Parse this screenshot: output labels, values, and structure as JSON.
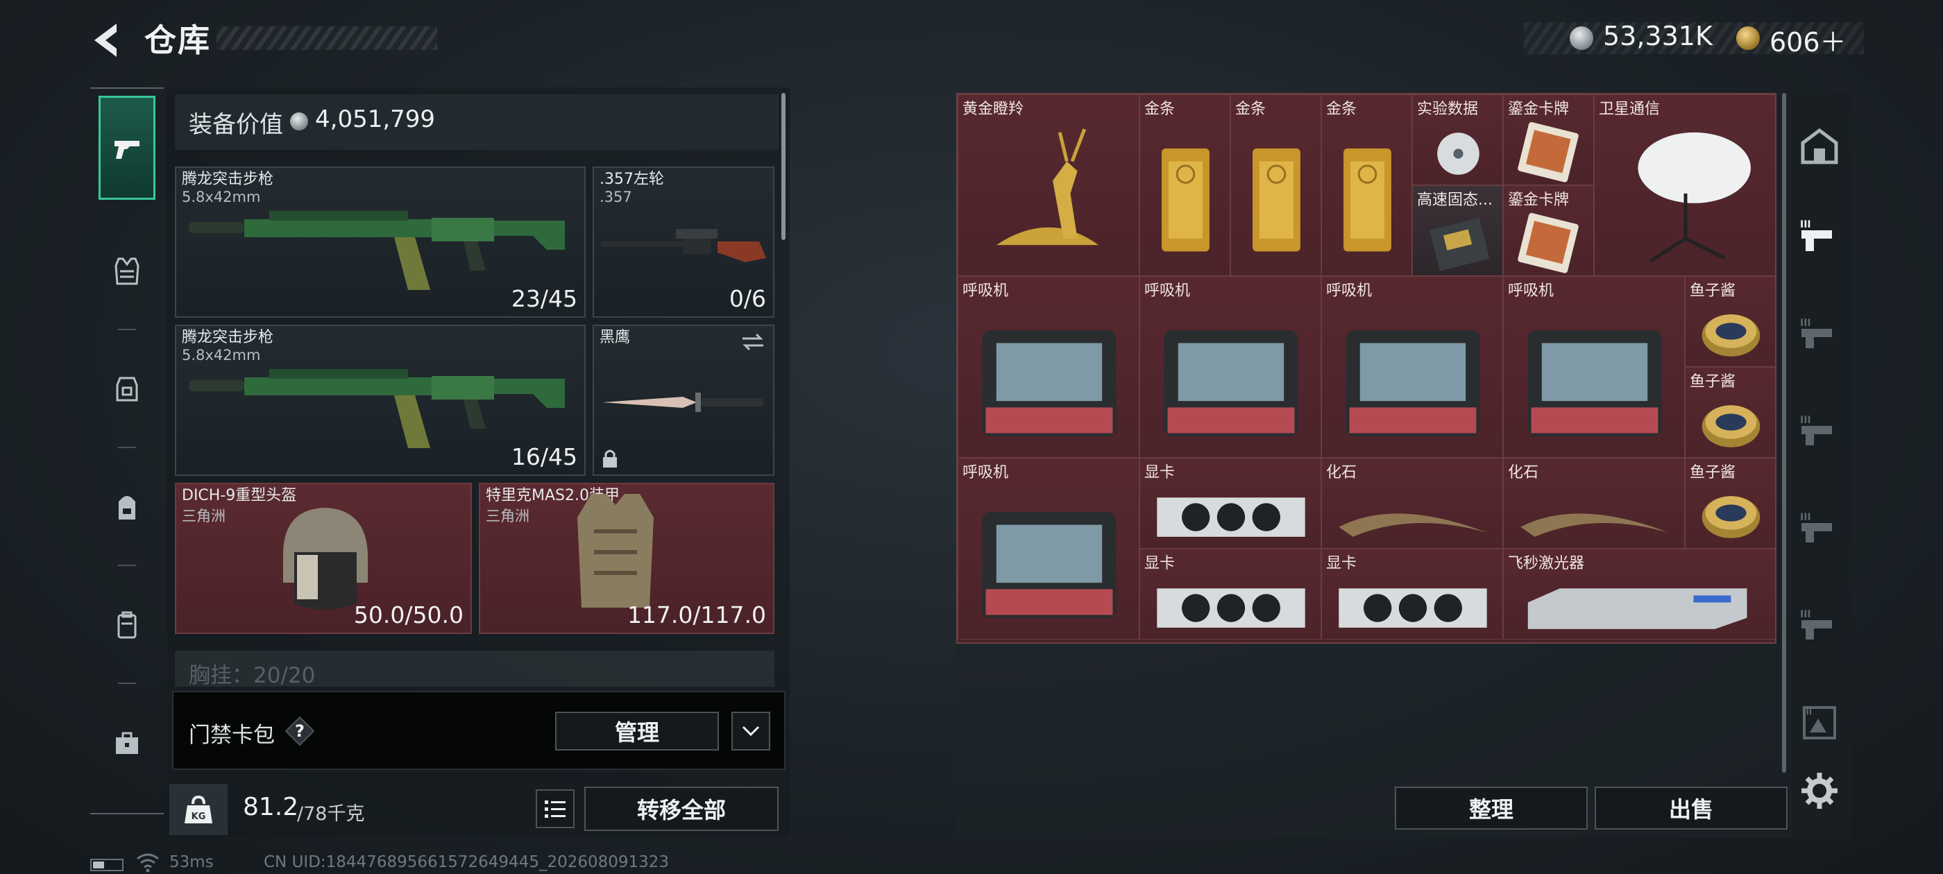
{
  "header": {
    "title": "仓库",
    "money_silver": "53,331K",
    "money_gold": "606＋"
  },
  "equipment": {
    "label": "装备价值",
    "value": "4,051,799",
    "slots": [
      {
        "name": "腾龙突击步枪",
        "sub": "5.8x42mm",
        "value": "23/45"
      },
      {
        "name": ".357左轮",
        "sub": ".357",
        "value": "0/6"
      },
      {
        "name": "腾龙突击步枪",
        "sub": "5.8x42mm",
        "value": "16/45"
      },
      {
        "name": "黑鹰",
        "sub": "",
        "value": ""
      },
      {
        "name": "DICH-9重型头盔",
        "sub": "三角洲",
        "value": "50.0/50.0"
      },
      {
        "name": "特里克MAS2.0装甲",
        "sub": "三角洲",
        "value": "117.0/117.0"
      }
    ],
    "chest_label": "胸挂：20/20"
  },
  "card_pack": {
    "label": "门禁卡包",
    "help": "?",
    "manage": "管理"
  },
  "weight": {
    "current": "81.2",
    "max": "/78千克",
    "icon_text": "KG"
  },
  "buttons": {
    "transfer_all": "转移全部",
    "sort": "整理",
    "sell": "出售"
  },
  "status": {
    "ping": "53ms",
    "uid": "CN UID:1844768956615726494​45_202608091323"
  },
  "storage_items": [
    {
      "label": "黄金瞪羚",
      "icon": "gold-gazelle-icon"
    },
    {
      "label": "金条",
      "icon": "gold-bar-icon"
    },
    {
      "label": "金条",
      "icon": "gold-bar-icon"
    },
    {
      "label": "金条",
      "icon": "gold-bar-icon"
    },
    {
      "label": "实验数据",
      "icon": "data-disc-icon"
    },
    {
      "label": "鎏金卡牌",
      "icon": "gilded-card-icon"
    },
    {
      "label": "卫星通信",
      "icon": "satellite-dish-icon"
    },
    {
      "label": "高速固态...",
      "icon": "ssd-icon"
    },
    {
      "label": "鎏金卡牌",
      "icon": "gilded-card-icon"
    },
    {
      "label": "呼吸机",
      "icon": "ventilator-icon"
    },
    {
      "label": "呼吸机",
      "icon": "ventilator-icon"
    },
    {
      "label": "呼吸机",
      "icon": "ventilator-icon"
    },
    {
      "label": "呼吸机",
      "icon": "ventilator-icon"
    },
    {
      "label": "鱼子酱",
      "icon": "caviar-tin-icon"
    },
    {
      "label": "鱼子酱",
      "icon": "caviar-tin-icon"
    },
    {
      "label": "呼吸机",
      "icon": "ventilator-icon"
    },
    {
      "label": "显卡",
      "icon": "graphics-card-icon"
    },
    {
      "label": "化石",
      "icon": "fossil-claw-icon"
    },
    {
      "label": "化石",
      "icon": "fossil-claw-icon"
    },
    {
      "label": "鱼子酱",
      "icon": "caviar-tin-icon"
    },
    {
      "label": "显卡",
      "icon": "graphics-card-icon"
    },
    {
      "label": "显卡",
      "icon": "graphics-card-icon"
    },
    {
      "label": "飞秒激光器",
      "icon": "femtosecond-laser-icon"
    }
  ],
  "colors": {
    "accent": "#3ac79a",
    "storage_bg": "#4a2228",
    "panel": "#1a2126"
  }
}
